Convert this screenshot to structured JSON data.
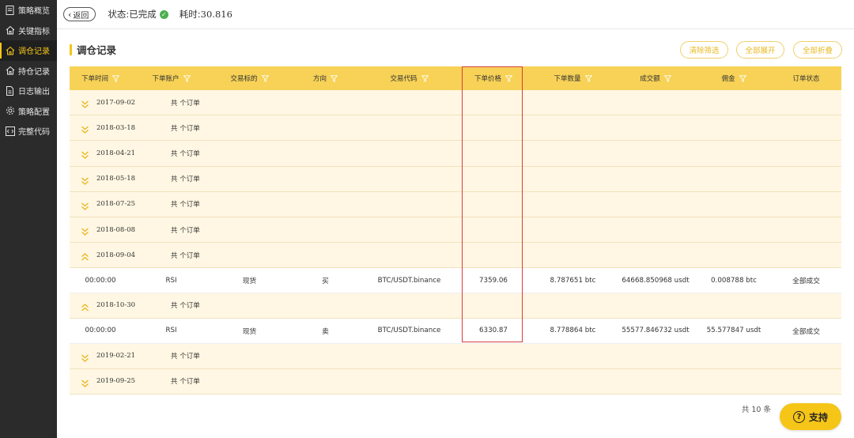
{
  "sidebar": {
    "items": [
      {
        "label": "策略概览",
        "icon": "doc-icon"
      },
      {
        "label": "关键指标",
        "icon": "home-icon"
      },
      {
        "label": "调仓记录",
        "icon": "home-icon",
        "active": true
      },
      {
        "label": "持仓记录",
        "icon": "home-icon"
      },
      {
        "label": "日志输出",
        "icon": "file-icon"
      },
      {
        "label": "策略配置",
        "icon": "gear-icon"
      },
      {
        "label": "完整代码",
        "icon": "code-icon"
      }
    ]
  },
  "header": {
    "back_label": "返回",
    "status_label": "状态:已完成",
    "elapsed_label": "耗时:",
    "elapsed_value": "30.816"
  },
  "panel": {
    "title": "调仓记录",
    "buttons": {
      "clear_filter": "清除筛选",
      "expand_all": "全部展开",
      "collapse_all": "全部折叠"
    }
  },
  "table": {
    "columns": [
      "下单时间",
      "下单账户",
      "交易标的",
      "方向",
      "交易代码",
      "下单价格",
      "下单数量",
      "成交额",
      "佣金",
      "订单状态"
    ],
    "group_count_text": "共 个订单",
    "groups": [
      {
        "date": "2017-09-02",
        "expanded": false
      },
      {
        "date": "2018-03-18",
        "expanded": false
      },
      {
        "date": "2018-04-21",
        "expanded": false
      },
      {
        "date": "2018-05-18",
        "expanded": false
      },
      {
        "date": "2018-07-25",
        "expanded": false
      },
      {
        "date": "2018-08-08",
        "expanded": false
      },
      {
        "date": "2018-09-04",
        "expanded": true,
        "rows": [
          [
            "00:00:00",
            "RSI",
            "现货",
            "买",
            "BTC/USDT.binance",
            "7359.06",
            "8.787651 btc",
            "64668.850968 usdt",
            "0.008788 btc",
            "全部成交"
          ]
        ]
      },
      {
        "date": "2018-10-30",
        "expanded": true,
        "rows": [
          [
            "00:00:00",
            "RSI",
            "现货",
            "卖",
            "BTC/USDT.binance",
            "6330.87",
            "8.778864 btc",
            "55577.846732 usdt",
            "55.577847 usdt",
            "全部成交"
          ]
        ]
      },
      {
        "date": "2019-02-21",
        "expanded": false
      },
      {
        "date": "2019-09-25",
        "expanded": false
      }
    ]
  },
  "footer": {
    "total": "共 10 条",
    "support_label": "支持"
  },
  "colors": {
    "accent": "#f5c518",
    "header_row": "#f7d256",
    "group_row": "#fff7e3",
    "highlight": "#d93d3d",
    "sidebar": "#2b2b2b"
  }
}
